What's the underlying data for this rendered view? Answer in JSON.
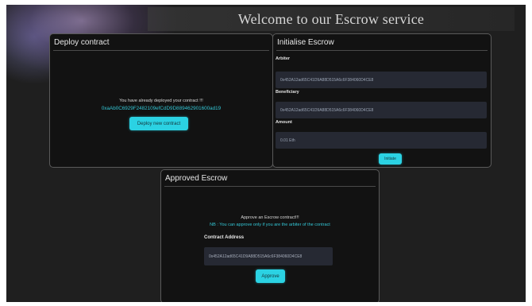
{
  "page": {
    "title": "Welcome to our Escrow service"
  },
  "deploy": {
    "header": "Deploy contract",
    "message": "You have already deployed your contract !!!",
    "address": "0xaAb0C6929F2482109efCdD9D889462901600ad19",
    "button": "Deploy new contract"
  },
  "init": {
    "header": "Initialise Escrow",
    "arbiter_label": "Arbiter",
    "arbiter_value": "0x452A12ad65C41D9A88D515A6c6F384060D4CE8",
    "beneficiary_label": "Beneficiary",
    "beneficiary_value": "0x452A12ad65C41D9A88D515A6c6F384060D4CE8",
    "amount_label": "Amount",
    "amount_value": "0.01 Eth",
    "button": "Initiate"
  },
  "approved": {
    "header": "Approved Escrow",
    "message": "Approve an Escrow contract!!!",
    "note": "NB : You can approve only if you are the arbiter of the contract",
    "address_label": "Contract Address",
    "address_value": "0x452A12ad65C41D9A88D515A6c6F384060D4CE8",
    "button": "Approve"
  },
  "colors": {
    "accent": "#2bd2e3",
    "panel": "#121212",
    "background": "#1f1f1f"
  }
}
